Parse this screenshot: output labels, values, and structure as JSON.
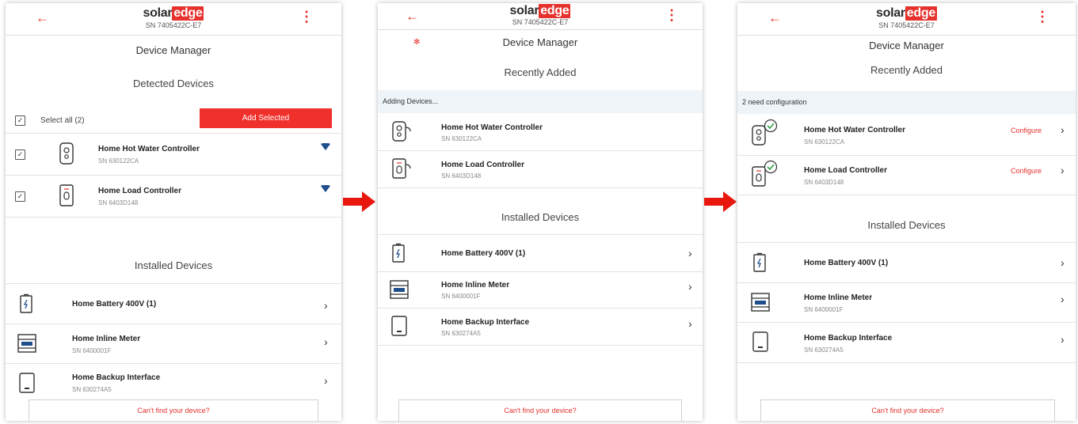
{
  "colors": {
    "brand_red": "#e6312c",
    "bar_bg": "#eef4f8"
  },
  "header": {
    "back_icon": "back-arrow-icon",
    "menu_icon": "kebab-menu-icon",
    "logo_word": "solar",
    "logo_emph": "edge",
    "serial": "SN 7405422C-E7"
  },
  "panel1": {
    "title": "Device Manager",
    "detected_heading": "Detected Devices",
    "select_all_label": "Select all (2)",
    "add_selected_label": "Add Selected",
    "detected": [
      {
        "name": "Home Hot Water Controller",
        "sn": "SN 630122CA",
        "checked": "✓",
        "icon": "hot-water-controller-icon",
        "signal_icon": "wifi-signal-icon"
      },
      {
        "name": "Home Load Controller",
        "sn": "SN 6403D148",
        "checked": "✓",
        "icon": "load-controller-icon",
        "signal_icon": "wifi-signal-icon"
      }
    ],
    "installed_heading": "Installed Devices",
    "installed": [
      {
        "name": "Home Battery 400V (1)",
        "sn": "",
        "icon": "battery-icon"
      },
      {
        "name": "Home Inline Meter",
        "sn": "SN 6400001F",
        "icon": "inline-meter-icon"
      },
      {
        "name": "Home Backup Interface",
        "sn": "SN 630274A5",
        "icon": "backup-interface-icon"
      }
    ],
    "footer_link": "Can't find your device?"
  },
  "panel2": {
    "title": "Device Manager",
    "recent_heading": "Recently Added",
    "status_bar": "Adding Devices...",
    "recent": [
      {
        "name": "Home Hot Water Controller",
        "sn": "SN 630122CA",
        "icon": "hot-water-controller-icon"
      },
      {
        "name": "Home Load Controller",
        "sn": "SN 6403D148",
        "icon": "load-controller-icon"
      }
    ],
    "installed_heading": "Installed Devices",
    "installed": [
      {
        "name": "Home Battery 400V (1)",
        "sn": "",
        "icon": "battery-icon"
      },
      {
        "name": "Home Inline Meter",
        "sn": "SN 6400001F",
        "icon": "inline-meter-icon"
      },
      {
        "name": "Home Backup Interface",
        "sn": "SN 630274A5",
        "icon": "backup-interface-icon"
      }
    ],
    "footer_link": "Can't find your device?"
  },
  "panel3": {
    "title": "Device Manager",
    "recent_heading": "Recently Added",
    "status_bar": "2 need configuration",
    "recent": [
      {
        "name": "Home Hot Water Controller",
        "sn": "SN 630122CA",
        "action": "Configure",
        "icon": "hot-water-controller-icon",
        "badge_icon": "check-circle-icon"
      },
      {
        "name": "Home Load Controller",
        "sn": "SN 6403D148",
        "action": "Configure",
        "icon": "load-controller-icon",
        "badge_icon": "check-circle-icon"
      }
    ],
    "installed_heading": "Installed Devices",
    "installed": [
      {
        "name": "Home Battery 400V (1)",
        "sn": "",
        "icon": "battery-icon"
      },
      {
        "name": "Home Inline Meter",
        "sn": "SN 6400001F",
        "icon": "inline-meter-icon"
      },
      {
        "name": "Home Backup Interface",
        "sn": "SN 630274A5",
        "icon": "backup-interface-icon"
      }
    ],
    "footer_link": "Can't find your device?"
  },
  "flow_arrows": [
    "right-arrow-icon",
    "right-arrow-icon"
  ]
}
